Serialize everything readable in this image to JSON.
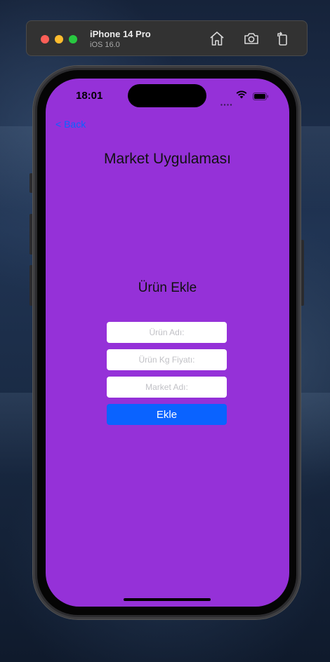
{
  "simulator": {
    "device_name": "iPhone 14 Pro",
    "os_version": "iOS 16.0",
    "icons": [
      "home-icon",
      "screenshot-icon",
      "rotate-icon"
    ]
  },
  "status_bar": {
    "time": "18:01",
    "icons": [
      "signal-icon",
      "wifi-icon",
      "battery-icon"
    ]
  },
  "nav": {
    "back_label": "< Back"
  },
  "app": {
    "title": "Market Uygulaması",
    "section_title": "Ürün Ekle",
    "fields": {
      "product_name_placeholder": "Ürün Adı:",
      "price_per_kg_placeholder": "Ürün Kg Fiyatı:",
      "market_name_placeholder": "Market Adı:"
    },
    "submit_label": "Ekle"
  },
  "colors": {
    "screen_background": "#9531d8",
    "accent": "#0a63ff"
  }
}
